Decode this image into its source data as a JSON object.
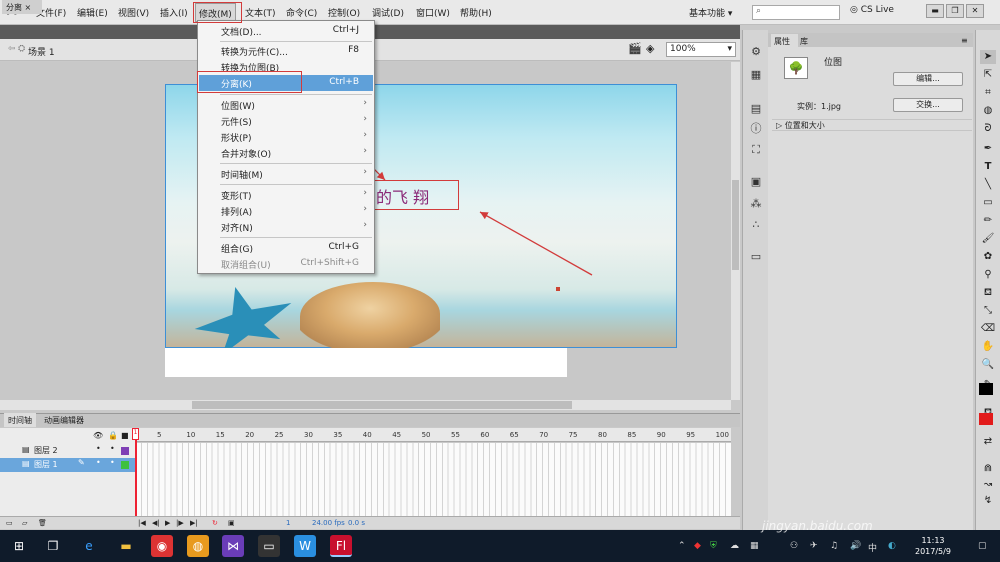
{
  "app": {
    "logo": "Fl"
  },
  "menubar": {
    "items": [
      "文件(F)",
      "编辑(E)",
      "视图(V)",
      "插入(I)",
      "修改(M)",
      "文本(T)",
      "命令(C)",
      "控制(O)",
      "调试(D)",
      "窗口(W)",
      "帮助(H)"
    ],
    "workspace": "基本功能",
    "cslive": "CS Live"
  },
  "document": {
    "tab": "分离",
    "scene": "场景 1",
    "zoom": "100%"
  },
  "modify_menu": {
    "items": [
      {
        "label": "文档(D)...",
        "shortcut": "Ctrl+J",
        "submenu": false,
        "disabled": false
      },
      {
        "label": "转换为元件(C)...",
        "shortcut": "F8",
        "submenu": false,
        "disabled": false
      },
      {
        "label": "转换为位图(B)",
        "shortcut": "",
        "submenu": false,
        "disabled": false
      },
      {
        "label": "分离(K)",
        "shortcut": "Ctrl+B",
        "submenu": false,
        "disabled": false,
        "highlighted": true
      },
      {
        "label": "位图(W)",
        "shortcut": "",
        "submenu": true,
        "disabled": false
      },
      {
        "label": "元件(S)",
        "shortcut": "",
        "submenu": true,
        "disabled": false
      },
      {
        "label": "形状(P)",
        "shortcut": "",
        "submenu": true,
        "disabled": false
      },
      {
        "label": "合并对象(O)",
        "shortcut": "",
        "submenu": true,
        "disabled": false
      },
      {
        "label": "时间轴(M)",
        "shortcut": "",
        "submenu": true,
        "disabled": false
      },
      {
        "label": "变形(T)",
        "shortcut": "",
        "submenu": true,
        "disabled": false
      },
      {
        "label": "排列(A)",
        "shortcut": "",
        "submenu": true,
        "disabled": false
      },
      {
        "label": "对齐(N)",
        "shortcut": "",
        "submenu": true,
        "disabled": false
      },
      {
        "label": "组合(G)",
        "shortcut": "Ctrl+G",
        "submenu": false,
        "disabled": false
      },
      {
        "label": "取消组合(U)",
        "shortcut": "Ctrl+Shift+G",
        "submenu": false,
        "disabled": true
      }
    ]
  },
  "stage": {
    "annotation_text": "的飞 翔"
  },
  "properties": {
    "tabs": [
      "属性",
      "库"
    ],
    "object_type": "位图",
    "edit_button": "编辑...",
    "instance_label": "实例：1.jpg",
    "swap_button": "交换...",
    "section": "位置和大小"
  },
  "timeline": {
    "tabs": [
      "时间轴",
      "动画编辑器"
    ],
    "layers": [
      {
        "name": "图层 2",
        "selected": false
      },
      {
        "name": "图层 1",
        "selected": true
      }
    ],
    "frame_numbers": [
      "5",
      "10",
      "15",
      "20",
      "25",
      "30",
      "35",
      "40",
      "45",
      "50",
      "55",
      "60",
      "65",
      "70",
      "75",
      "80",
      "85",
      "90",
      "95",
      "100"
    ],
    "current_frame": "1",
    "fps": "24.00 fps",
    "time": "0.0 s"
  },
  "taskbar": {
    "ime": "中",
    "time": "11:13",
    "date": "2017/5/9"
  },
  "watermark": "jingyan.baidu.com"
}
